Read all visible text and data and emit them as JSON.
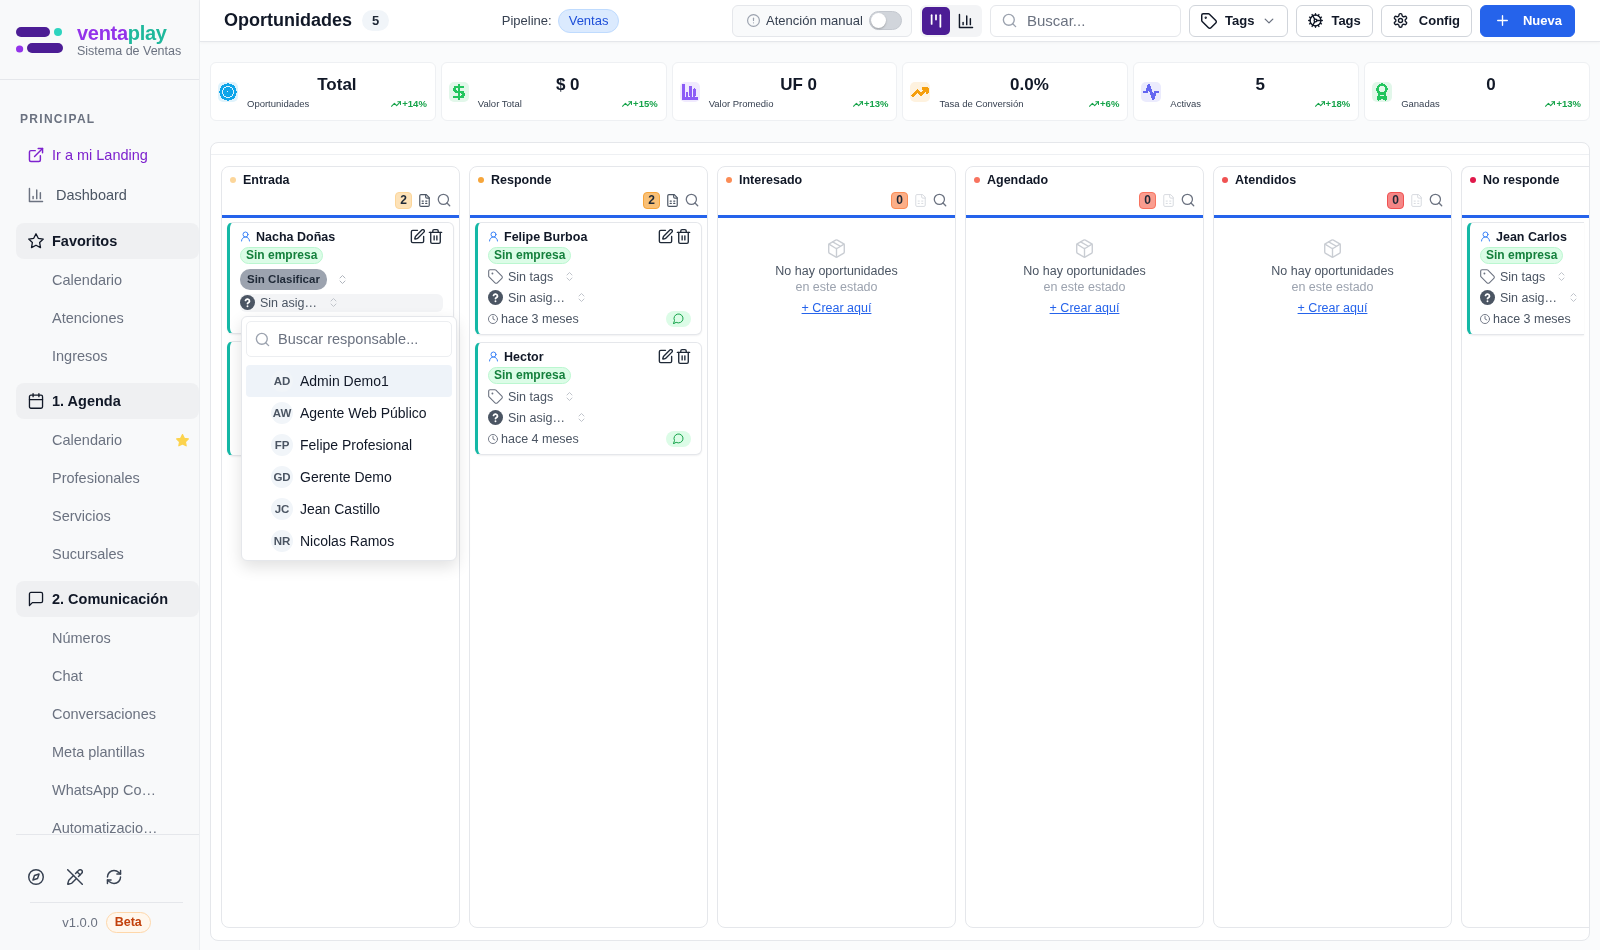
{
  "sidebar": {
    "brand": {
      "part_1": "venta",
      "part_2": "play"
    },
    "subtitle": "Sistema de Ventas",
    "section_label": "PRINCIPAL",
    "nav": [
      {
        "kind": "link",
        "label": "Ir a mi Landing"
      },
      {
        "kind": "page",
        "label": "Dashboard"
      },
      {
        "kind": "group",
        "label": "Favoritos",
        "children": [
          {
            "label": "Calendario",
            "favorite": false
          },
          {
            "label": "Atenciones",
            "favorite": false
          },
          {
            "label": "Ingresos",
            "favorite": false
          }
        ]
      },
      {
        "kind": "group",
        "label": "1. Agenda",
        "children": [
          {
            "label": "Calendario",
            "favorite": true
          },
          {
            "label": "Profesionales",
            "favorite": false
          },
          {
            "label": "Servicios",
            "favorite": false
          },
          {
            "label": "Sucursales",
            "favorite": false
          }
        ]
      },
      {
        "kind": "group",
        "label": "2. Comunicación",
        "children": [
          {
            "label": "Números",
            "favorite": false
          },
          {
            "label": "Chat",
            "favorite": false
          },
          {
            "label": "Conversaciones",
            "favorite": false
          },
          {
            "label": "Meta plantillas",
            "favorite": false
          },
          {
            "label": "WhatsApp Co…",
            "favorite": false
          },
          {
            "label": "Automatizacio…",
            "favorite": false
          }
        ]
      }
    ],
    "version": "v1.0.0",
    "version_badge": "Beta"
  },
  "header": {
    "title": "Oportunidades",
    "count": "5",
    "pipeline_label": "Pipeline:",
    "pipeline": "Ventas",
    "manual_attention": {
      "label": "Atención manual",
      "on": false
    },
    "views": [
      {
        "kind": "kanban",
        "selected": true
      },
      {
        "kind": "chart",
        "selected": false
      }
    ],
    "search": {
      "placeholder": "Buscar..."
    },
    "buttons": [
      {
        "kind": "tag-filter",
        "label": "Tags"
      },
      {
        "kind": "tag-settings",
        "label": "Tags"
      },
      {
        "kind": "config",
        "label": "Config"
      },
      {
        "kind": "create",
        "label": "Nueva"
      }
    ]
  },
  "stats": [
    {
      "value": "Total",
      "label": "Oportunidades",
      "trend": "+14%",
      "color": "#0ea5e9"
    },
    {
      "value": "$ 0",
      "label": "Valor Total",
      "trend": "+15%",
      "color": "#22c55e"
    },
    {
      "value": "UF 0",
      "label": "Valor Promedio",
      "trend": "+13%",
      "color": "#8b5cf6"
    },
    {
      "value": "0.0%",
      "label": "Tasa de Conversión",
      "trend": "+6%",
      "color": "#f59e0b"
    },
    {
      "value": "5",
      "label": "Activas",
      "trend": "+18%",
      "color": "#6366f1"
    },
    {
      "value": "0",
      "label": "Ganadas",
      "trend": "+13%",
      "color": "#22c55e"
    }
  ],
  "board": {
    "columns": [
      {
        "title": "Entrada",
        "color": "#fcd69a",
        "count": "2",
        "tools": true,
        "export_enabled": true,
        "cards": [
          {
            "covered": false,
            "name": "Nacha Doñas",
            "actions": true,
            "company": "Sin empresa",
            "classification": "Sin Clasificar",
            "assignee": "Sin asig…",
            "assignee_menu": {
              "search_placeholder": "Buscar responsable...",
              "options": [
                {
                  "initials": "AD",
                  "name": "Admin Demo1",
                  "selected": true
                },
                {
                  "initials": "AW",
                  "name": "Agente Web Público",
                  "selected": false
                },
                {
                  "initials": "FP",
                  "name": "Felipe Profesional",
                  "selected": false
                },
                {
                  "initials": "GD",
                  "name": "Gerente Demo",
                  "selected": false
                },
                {
                  "initials": "JC",
                  "name": "Jean Castillo",
                  "selected": false
                },
                {
                  "initials": "NR",
                  "name": "Nicolas Ramos",
                  "selected": false
                }
              ]
            }
          },
          {
            "covered": true
          }
        ]
      },
      {
        "title": "Responde",
        "color": "#f6a53b",
        "count": "2",
        "tools": true,
        "export_enabled": true,
        "cards": [
          {
            "covered": false,
            "name": "Felipe Burboa",
            "actions": true,
            "company": "Sin empresa",
            "tags": "Sin tags",
            "assignee": "Sin asig…",
            "time": "hace 3 meses",
            "chat": true
          },
          {
            "covered": false,
            "name": "Hector",
            "actions": true,
            "company": "Sin empresa",
            "tags": "Sin tags",
            "assignee": "Sin asig…",
            "time": "hace 4 meses",
            "chat": true
          }
        ]
      },
      {
        "title": "Interesado",
        "color": "#fb8c55",
        "count": "0",
        "tools": true,
        "export_enabled": false,
        "empty": {
          "message": "No hay oportunidades",
          "hint": "en este estado",
          "action": "+ Crear aquí"
        }
      },
      {
        "title": "Agendado",
        "color": "#f8735f",
        "count": "0",
        "tools": true,
        "export_enabled": false,
        "empty": {
          "message": "No hay oportunidades",
          "hint": "en este estado",
          "action": "+ Crear aquí"
        }
      },
      {
        "title": "Atendidos",
        "color": "#f05252",
        "count": "0",
        "tools": true,
        "export_enabled": false,
        "empty": {
          "message": "No hay oportunidades",
          "hint": "en este estado",
          "action": "+ Crear aquí"
        }
      },
      {
        "title": "No responde",
        "color": "#e0194a",
        "tools": false,
        "cards": [
          {
            "covered": false,
            "name": "Jean Carlos",
            "actions": false,
            "company": "Sin empresa",
            "tags": "Sin tags",
            "assignee": "Sin asig…",
            "time": "hace 3 meses",
            "chat": false
          }
        ]
      }
    ]
  }
}
